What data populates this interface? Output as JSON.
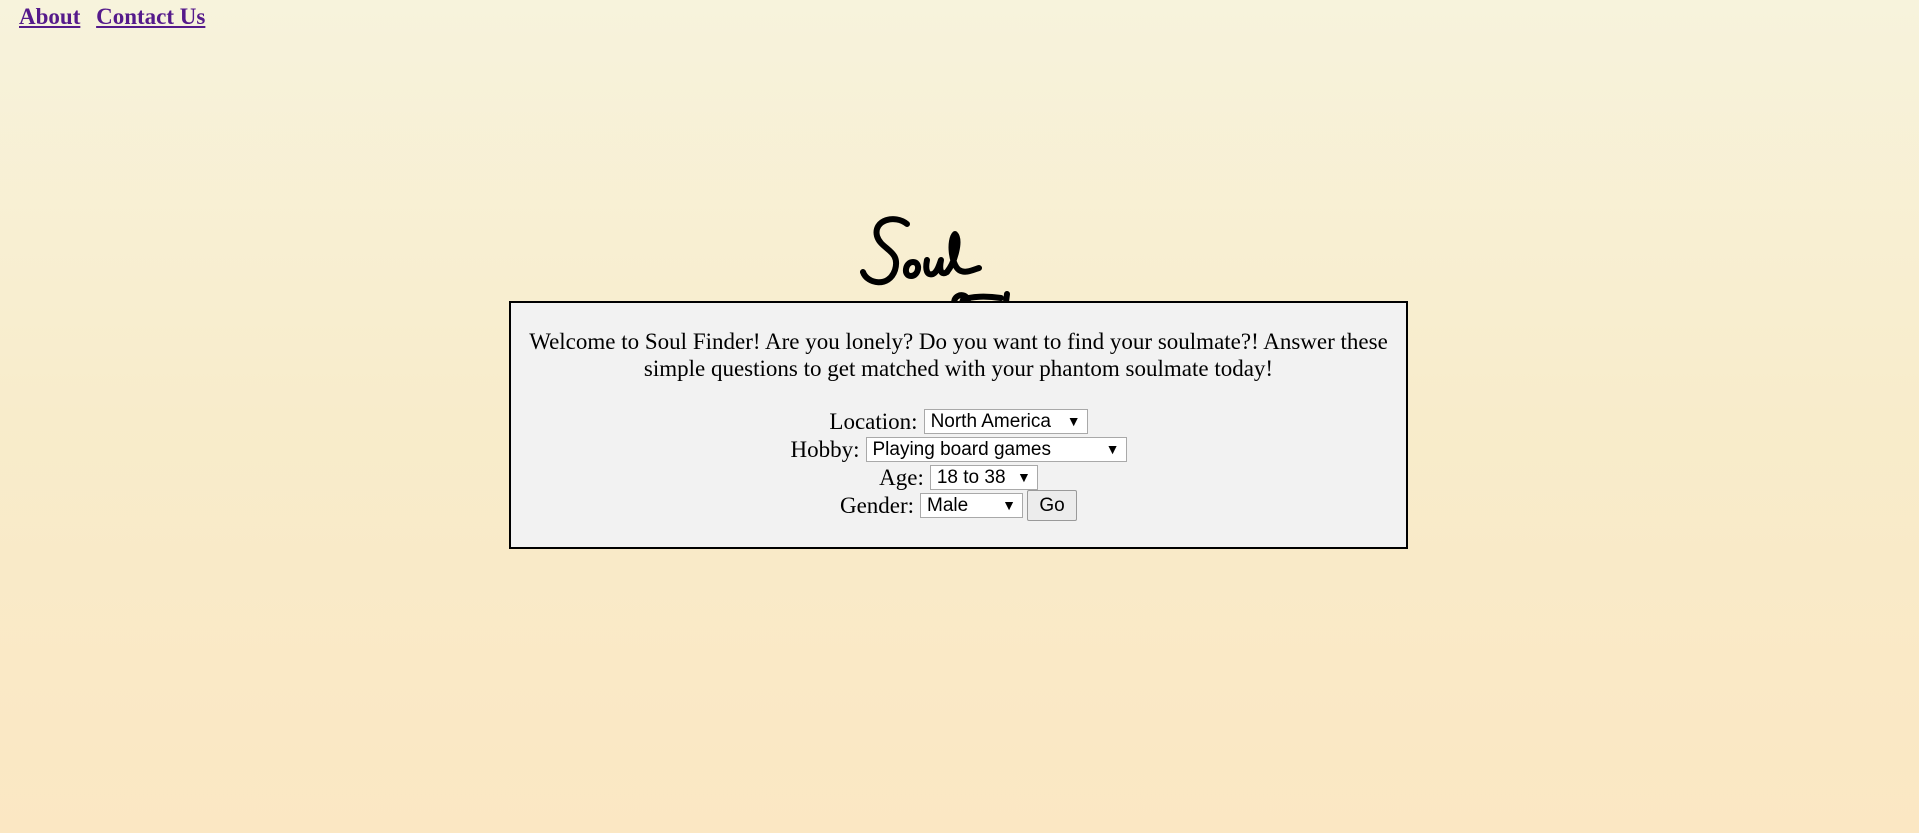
{
  "nav": {
    "about": "About",
    "contact": "Contact Us"
  },
  "logo": {
    "text": "Soul Finder"
  },
  "intro": "Welcome to Soul Finder! Are you lonely? Do you want to find your soulmate?! Answer these simple questions to get matched with your phantom soulmate today!",
  "form": {
    "location": {
      "label": "Location:",
      "value": "North America"
    },
    "hobby": {
      "label": "Hobby:",
      "value": "Playing board games"
    },
    "age": {
      "label": "Age:",
      "value": "18 to 38"
    },
    "gender": {
      "label": "Gender:",
      "value": "Male"
    },
    "go": "Go"
  },
  "icons": {
    "dropdown": "triangle-down"
  },
  "colors": {
    "link": "#551a8b",
    "panel_bg": "#f2f2f2"
  }
}
